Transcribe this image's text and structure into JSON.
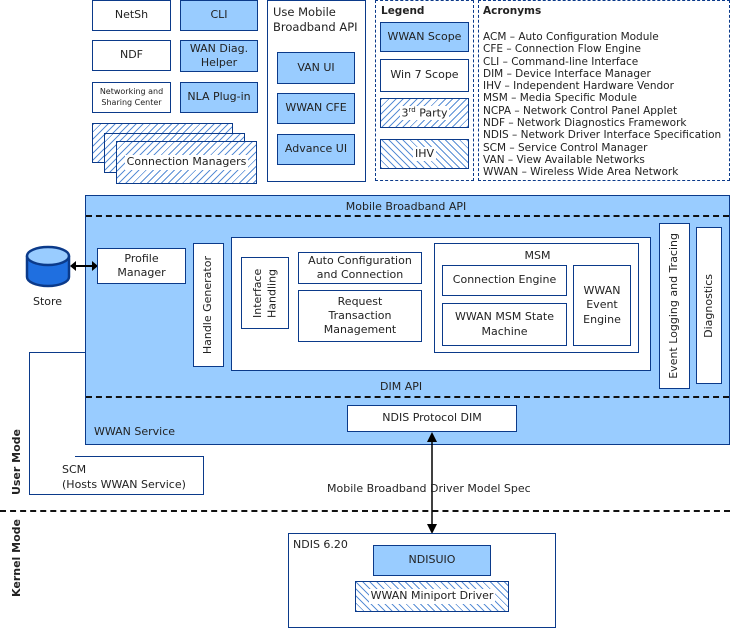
{
  "top_tools": {
    "netsh": "NetSh",
    "cli": "CLI",
    "ndf": "NDF",
    "wan_diag": "WAN Diag. Helper",
    "nsc": "Networking and Sharing Center",
    "nla": "NLA Plug-in",
    "connection_managers": "Connection Managers"
  },
  "mbapi_users": {
    "title": "Use Mobile Broadband API",
    "items": [
      "VAN UI",
      "WWAN CFE",
      "Advance UI"
    ]
  },
  "legend": {
    "title": "Legend",
    "items": [
      {
        "label": "WWAN Scope",
        "style": "blue"
      },
      {
        "label": "Win 7 Scope",
        "style": "white"
      },
      {
        "label": "3rd Party",
        "style": "hatch-forward"
      },
      {
        "label": "IHV",
        "style": "hatch-back"
      }
    ],
    "third_party_base": "3",
    "third_party_sup": "rd",
    "third_party_rest": " Party"
  },
  "acronyms": {
    "title": "Acronyms",
    "items": [
      "ACM – Auto Configuration Module",
      "CFE – Connection Flow Engine",
      "CLI – Command-line Interface",
      "DIM – Device Interface Manager",
      "IHV – Independent Hardware Vendor",
      "MSM – Media Specific Module",
      "NCPA – Network Control Panel Applet",
      "NDF – Network Diagnostics Framework",
      "NDIS – Network Driver Interface Specification",
      "SCM – Service Control Manager",
      "VAN – View Available Networks",
      "WWAN – Wireless Wide Area Network"
    ]
  },
  "store": {
    "label": "Store"
  },
  "service": {
    "mb_api": "Mobile Broadband API",
    "profile_manager": "Profile Manager",
    "handle_generator": "Handle Generator",
    "interface_handling": "Interface Handling",
    "auto_config": "Auto Configuration and Connection",
    "request_txn": "Request Transaction Management",
    "msm": "MSM",
    "connection_engine": "Connection Engine",
    "state_machine": "WWAN MSM State Machine",
    "event_engine": "WWAN Event Engine",
    "event_logging": "Event Logging and Tracing",
    "diagnostics": "Diagnostics",
    "dim_api": "DIM API",
    "ndis_protocol_dim": "NDIS Protocol DIM",
    "wwan_service": "WWAN Service"
  },
  "scm": {
    "line1": "SCM",
    "line2": "(Hosts WWAN Service)"
  },
  "modes": {
    "user": "User Mode",
    "kernel": "Kernel Mode"
  },
  "driver_spec": "Mobile Broadband Driver Model Spec",
  "kernel": {
    "ndis": "NDIS 6.20",
    "ndisuio": "NDISUIO",
    "miniport": "WWAN Miniport Driver"
  },
  "colors": {
    "wwan_scope": "#99ccff",
    "border": "#0b3a8a",
    "store": "#1f6fe0"
  }
}
